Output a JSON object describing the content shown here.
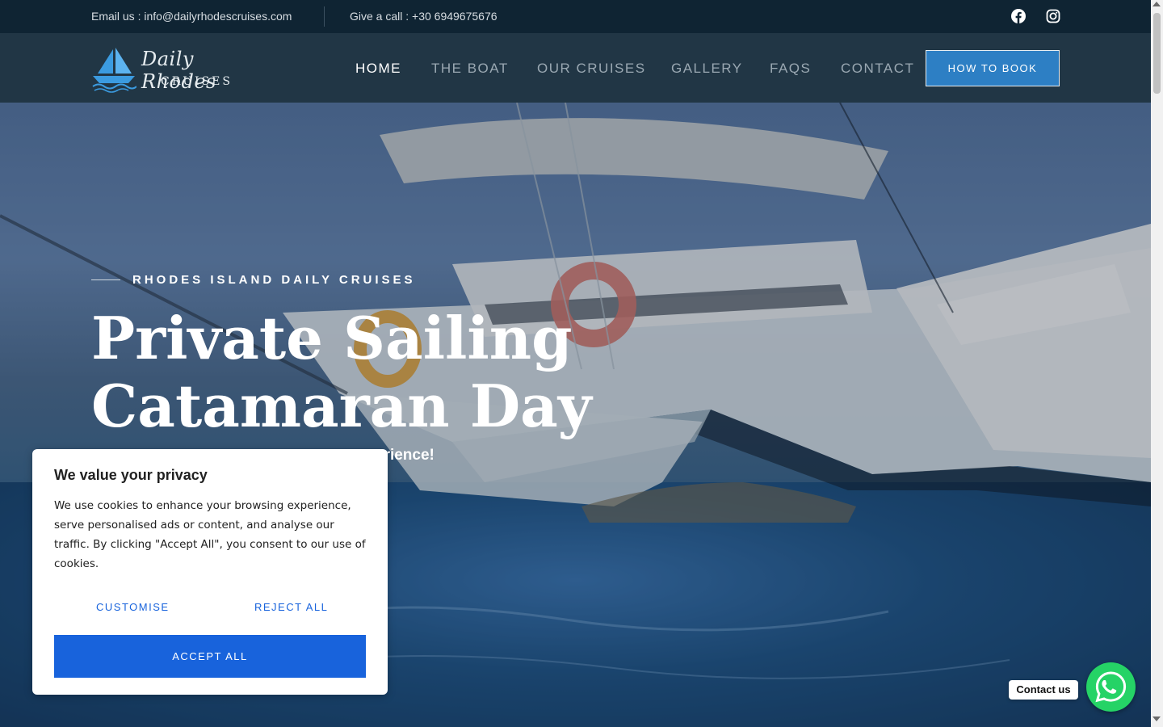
{
  "topbar": {
    "email_text": "Email us : info@dailyrhodescruises.com",
    "phone_text": "Give a call : +30 6949675676",
    "social": [
      "facebook-icon",
      "instagram-icon"
    ]
  },
  "logo": {
    "script": "Daily Rhodes",
    "caps": "CRUISES"
  },
  "nav": {
    "items": [
      {
        "label": "HOME",
        "active": true
      },
      {
        "label": "THE BOAT",
        "active": false
      },
      {
        "label": "OUR CRUISES",
        "active": false
      },
      {
        "label": "GALLERY",
        "active": false
      },
      {
        "label": "FAQS",
        "active": false
      },
      {
        "label": "CONTACT",
        "active": false
      }
    ],
    "cta": "HOW TO BOOK"
  },
  "hero": {
    "kicker": "RHODES ISLAND DAILY CRUISES",
    "title_line1": "Private Sailing",
    "title_line2": "Catamaran Day Cruise",
    "subtitle_visible": "erience!"
  },
  "cookie": {
    "title": "We value your privacy",
    "text": "We use cookies to enhance your browsing experience, serve personalised ads or content, and analyse our traffic. By clicking \"Accept All\", you consent to our use of cookies.",
    "customise": "CUSTOMISE",
    "reject": "REJECT ALL",
    "accept": "ACCEPT ALL"
  },
  "whatsapp": {
    "label": "Contact us"
  },
  "colors": {
    "topbar_bg": "#0f2433",
    "header_bg": "#213645",
    "accent_blue": "#2d7fc4",
    "cookie_blue": "#1863dc",
    "whatsapp_green": "#25d366"
  }
}
